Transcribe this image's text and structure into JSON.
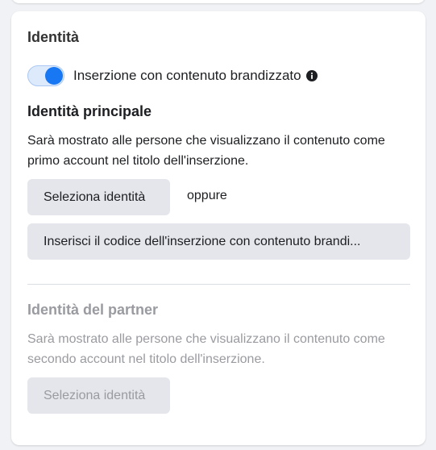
{
  "identity_section": {
    "title": "Identità",
    "branded_toggle": {
      "label": "Inserzione con contenuto brandizzato",
      "on": true,
      "info_icon": "info-icon"
    },
    "primary": {
      "heading": "Identità principale",
      "description": "Sarà mostrato alle persone che visualizzano il contenuto come primo account nel titolo dell'inserzione.",
      "select_button": "Seleziona identità",
      "or_text": "oppure",
      "code_button": "Inserisci il codice dell'inserzione con contenuto brandi..."
    },
    "partner": {
      "heading": "Identità del partner",
      "description": "Sarà mostrato alle persone che visualizzano il contenuto come secondo account nel titolo dell'inserzione.",
      "select_button": "Seleziona identità",
      "disabled": true
    }
  },
  "colors": {
    "accent": "#1877f2",
    "button_bg": "#e4e6eb",
    "muted_text": "#9a9ba0"
  }
}
